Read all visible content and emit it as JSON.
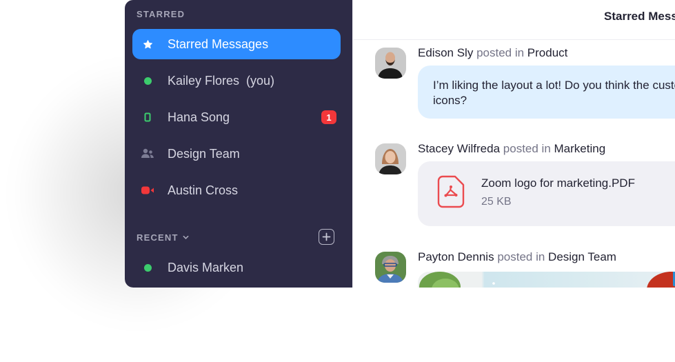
{
  "sidebar": {
    "starred_label": "STARRED",
    "recent_label": "RECENT",
    "starred_items": [
      {
        "label": "Starred Messages",
        "icon": "star-icon",
        "active": true
      },
      {
        "label": "Kailey Flores  (you)",
        "icon": "online-dot-icon"
      },
      {
        "label": "Hana Song",
        "icon": "mobile-icon",
        "badge": "1"
      },
      {
        "label": "Design Team",
        "icon": "group-icon"
      },
      {
        "label": "Austin Cross",
        "icon": "video-camera-icon"
      }
    ],
    "recent_items": [
      {
        "label": "Davis Marken",
        "icon": "online-dot-icon"
      }
    ],
    "colors": {
      "background": "#2d2b46",
      "active": "#2d8cff",
      "online": "#3ccc6d",
      "alert": "#f2373a"
    }
  },
  "header": {
    "title": "Starred Messages"
  },
  "messages": [
    {
      "author": "Edison Sly",
      "connector": "posted in",
      "channel": "Product",
      "text": "I’m liking the layout a lot! Do you think the custom icons?"
    },
    {
      "author": "Stacey Wilfreda",
      "connector": "posted in",
      "channel": "Marketing",
      "file": {
        "name": "Zoom logo for marketing.PDF",
        "size": "25 KB",
        "icon": "pdf-file-icon"
      }
    },
    {
      "author": "Payton Dennis",
      "connector": "posted in",
      "channel": "Design Team",
      "attachment": "image"
    }
  ]
}
